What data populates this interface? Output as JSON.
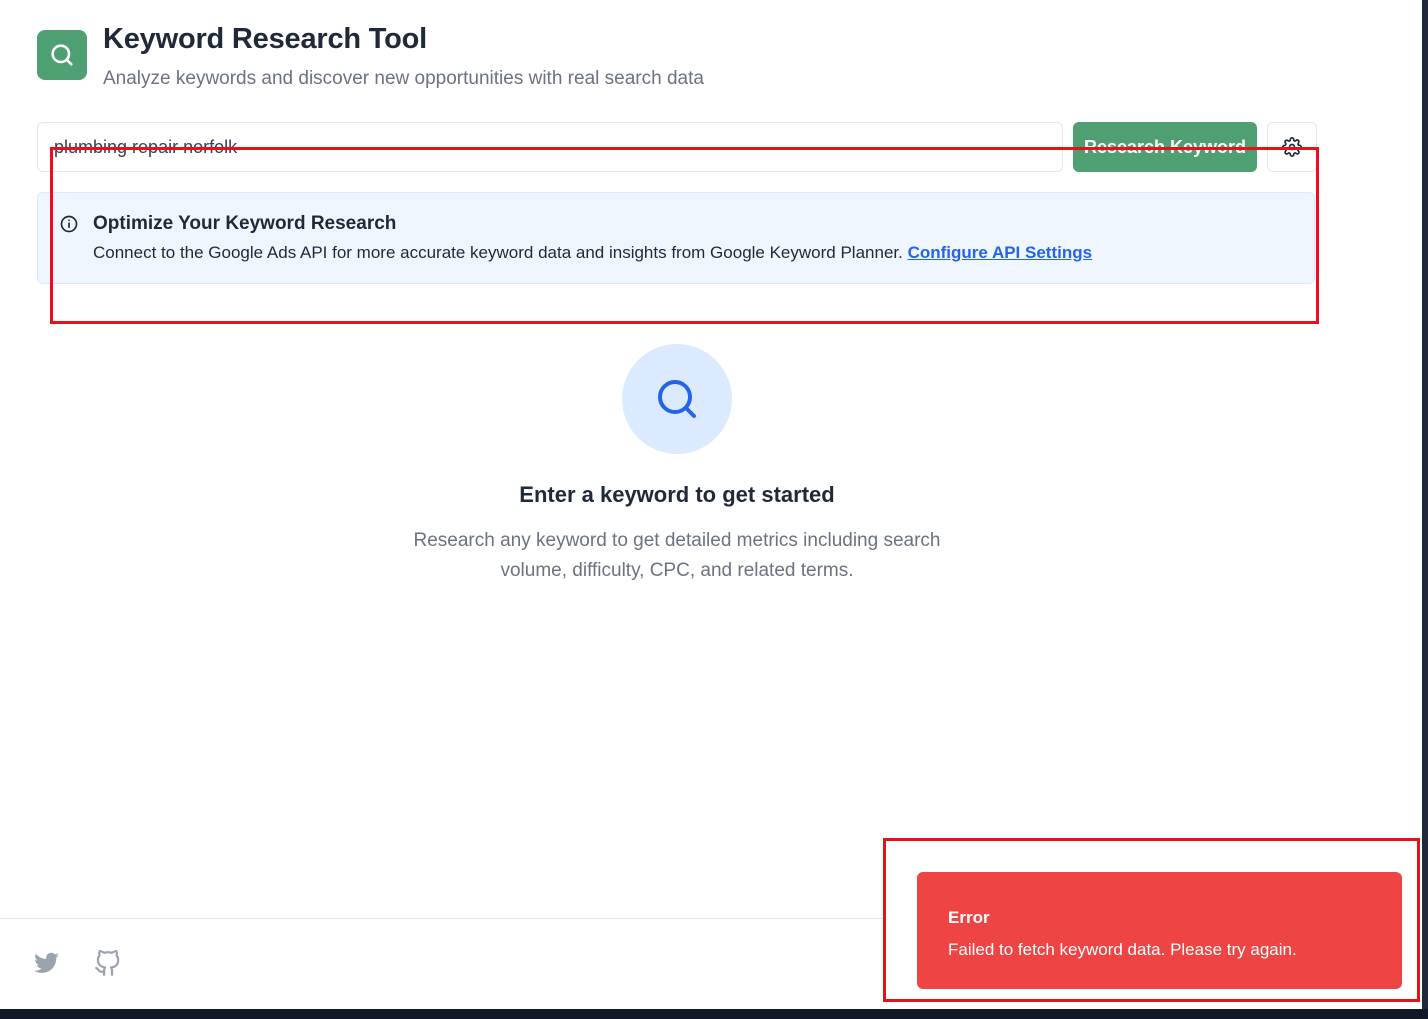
{
  "header": {
    "title": "Keyword Research Tool",
    "subtitle": "Analyze keywords and discover new opportunities with real search data",
    "logo_icon": "search-icon",
    "brand_color": "#4e9f72"
  },
  "search": {
    "value": "plumbing repair norfolk",
    "button_label": "Research Keyword",
    "settings_icon": "gear-icon"
  },
  "info": {
    "title": "Optimize Your Keyword Research",
    "text": "Connect to the Google Ads API for more accurate keyword data and insights from Google Keyword Planner. ",
    "link": "Configure API Settings"
  },
  "empty_state": {
    "title": "Enter a keyword to get started",
    "text": "Research any keyword to get detailed metrics including search volume, difficulty, CPC, and related terms."
  },
  "footer": {
    "icons": [
      "twitter-icon",
      "github-icon"
    ]
  },
  "toast": {
    "title": "Error",
    "message": "Failed to fetch keyword data. Please try again.",
    "color": "#ef4444"
  },
  "annotations": {
    "highlight_color": "#e8101a"
  }
}
